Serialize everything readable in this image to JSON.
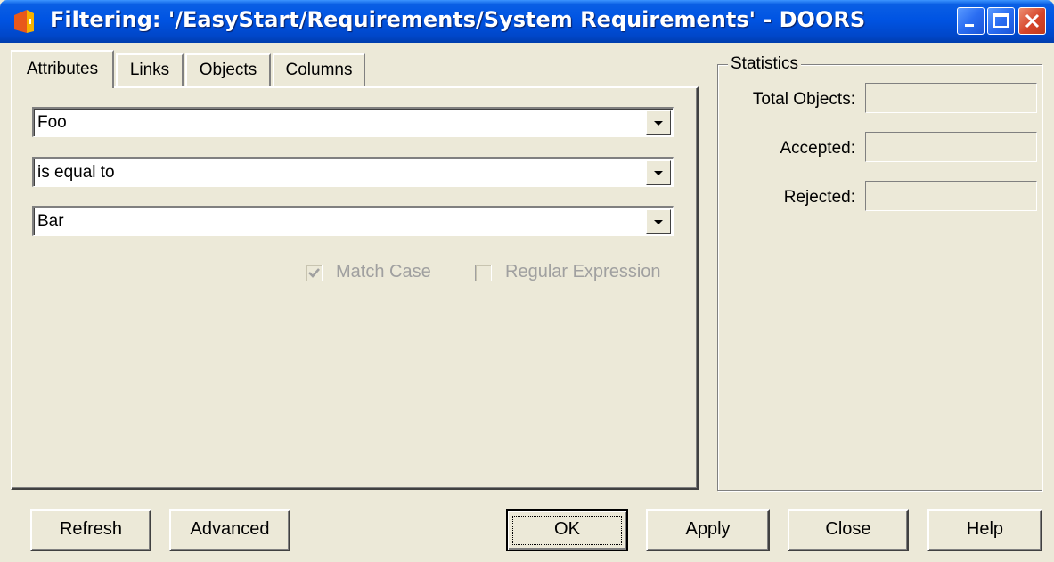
{
  "window": {
    "title": "Filtering: '/EasyStart/Requirements/System Requirements' - DOORS",
    "app_icon": "doors-app-icon",
    "controls": [
      "minimize-icon",
      "maximize-icon",
      "close-icon"
    ]
  },
  "tabs": [
    {
      "label": "Attributes",
      "active": true
    },
    {
      "label": "Links",
      "active": false
    },
    {
      "label": "Objects",
      "active": false
    },
    {
      "label": "Columns",
      "active": false
    }
  ],
  "filter": {
    "attribute": "Foo",
    "operator": "is equal to",
    "value": "Bar",
    "match_case": {
      "label": "Match Case",
      "checked": true,
      "enabled": false
    },
    "regular_expression": {
      "label": "Regular Expression",
      "checked": false,
      "enabled": false
    }
  },
  "statistics": {
    "title": "Statistics",
    "total_objects_label": "Total Objects:",
    "accepted_label": "Accepted:",
    "rejected_label": "Rejected:",
    "total_objects_value": "",
    "accepted_value": "",
    "rejected_value": ""
  },
  "buttons": {
    "refresh": "Refresh",
    "advanced": "Advanced",
    "ok": "OK",
    "apply": "Apply",
    "close": "Close",
    "help": "Help"
  },
  "colors": {
    "titlebar": "#0054e3",
    "dialog_bg": "#ece9d8",
    "close_button": "#d6452a",
    "disabled_text": "#a0a0a0"
  }
}
